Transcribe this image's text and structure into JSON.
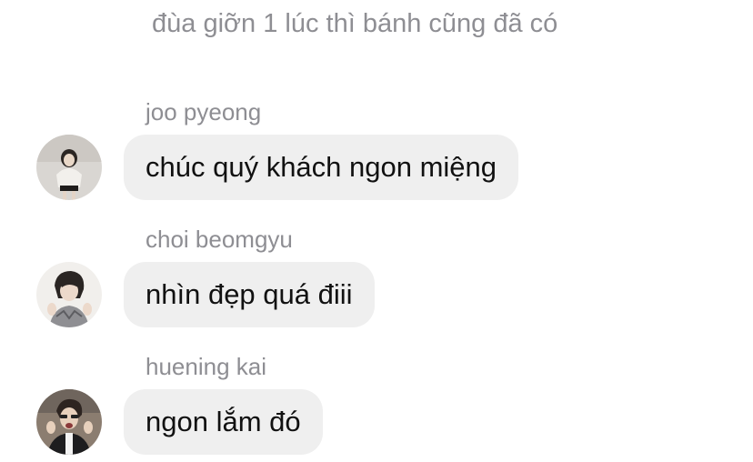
{
  "chat": {
    "previous_message": "đùa giỡn 1 lúc thì bánh cũng đã có",
    "messages": [
      {
        "sender": "joo pyeong",
        "text": "chúc quý khách ngon miệng",
        "avatar": "avatar-photo-joo-pyeong"
      },
      {
        "sender": "choi beomgyu",
        "text": "nhìn đẹp quá điii",
        "avatar": "avatar-photo-choi-beomgyu"
      },
      {
        "sender": "huening kai",
        "text": "ngon lắm đó",
        "avatar": "avatar-photo-huening-kai"
      }
    ]
  },
  "colors": {
    "background": "#ffffff",
    "bubble": "#efefef",
    "meta_text": "#8e8e93",
    "message_text": "#111111"
  }
}
